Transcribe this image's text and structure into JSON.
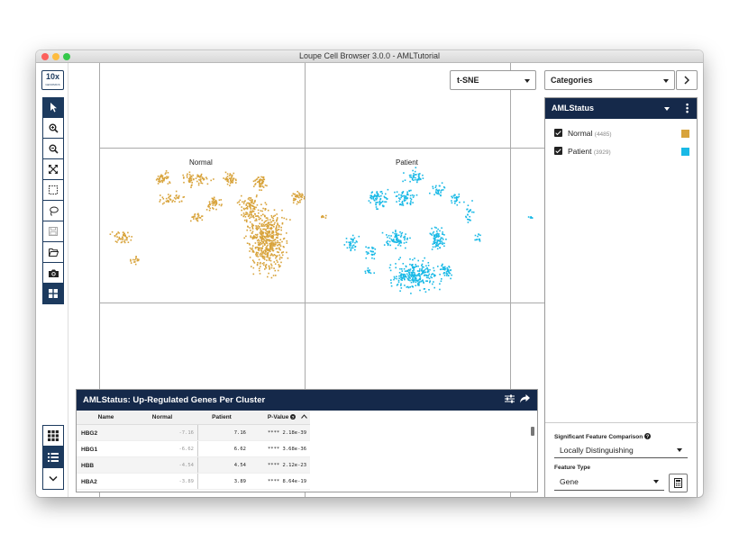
{
  "window": {
    "title": "Loupe Cell Browser 3.0.0 - AMLTutorial"
  },
  "logo": {
    "text": "10x",
    "sub": "GENOMICS"
  },
  "toolbar": {
    "tools": [
      {
        "name": "pointer-icon",
        "active": true
      },
      {
        "name": "zoom-in-icon",
        "active": false
      },
      {
        "name": "zoom-out-icon",
        "active": false
      },
      {
        "name": "fit-view-icon",
        "active": false
      },
      {
        "name": "box-select-icon",
        "active": false
      },
      {
        "name": "lasso-icon",
        "active": false
      },
      {
        "name": "save-icon",
        "active": false,
        "disabled": true
      },
      {
        "name": "folder-open-icon",
        "active": false
      },
      {
        "name": "camera-icon",
        "active": false
      },
      {
        "name": "grid-layout-icon",
        "active": true
      }
    ],
    "bottom": [
      {
        "name": "grid-view-icon",
        "active": false
      },
      {
        "name": "list-view-icon",
        "active": true
      },
      {
        "name": "chevron-down-icon",
        "active": false
      }
    ]
  },
  "projection": {
    "selected": "t-SNE"
  },
  "clusters": [
    {
      "label": "Normal",
      "color": "#d8a33b"
    },
    {
      "label": "Patient",
      "color": "#19b9e6"
    }
  ],
  "category_select": {
    "selected": "Categories"
  },
  "category_panel": {
    "title": "AMLStatus",
    "items": [
      {
        "label": "Normal",
        "count": "(4485)",
        "color": "#d8a33b"
      },
      {
        "label": "Patient",
        "count": "(3929)",
        "color": "#19b9e6"
      }
    ]
  },
  "significant_feature": {
    "label": "Significant Feature Comparison",
    "value": "Locally Distinguishing"
  },
  "feature_type": {
    "label": "Feature Type",
    "value": "Gene"
  },
  "genes_panel": {
    "title": "AMLStatus: Up-Regulated Genes Per Cluster",
    "columns": {
      "name": "Name",
      "normal": "Normal",
      "patient": "Patient",
      "pvalue": "P-Value"
    },
    "rows": [
      {
        "name": "HBG2",
        "normal": "-7.16",
        "patient": "7.16",
        "pvalue": "**** 2.18e-39"
      },
      {
        "name": "HBG1",
        "normal": "-6.62",
        "patient": "6.62",
        "pvalue": "**** 3.68e-36"
      },
      {
        "name": "HBB",
        "normal": "-4.54",
        "patient": "4.54",
        "pvalue": "**** 2.12e-23"
      },
      {
        "name": "HBA2",
        "normal": "-3.89",
        "patient": "3.89",
        "pvalue": "**** 8.64e-19"
      }
    ]
  }
}
